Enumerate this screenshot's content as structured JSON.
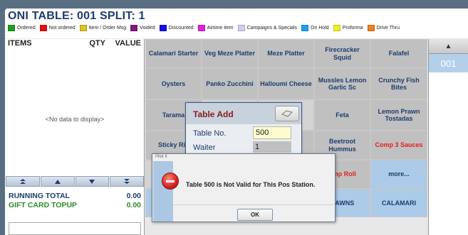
{
  "header": {
    "title": "ONI   TABLE: 001   SPLIT: 1",
    "legend": [
      {
        "label": "Ordered",
        "color": "#1aa01a"
      },
      {
        "label": "Not ordered",
        "color": "#e01010"
      },
      {
        "label": "Item / Order Msg",
        "color": "#e0c020"
      },
      {
        "label": "Voided",
        "color": "#801880"
      },
      {
        "label": "Discounted",
        "color": "#1010e0"
      },
      {
        "label": "Airtime item",
        "color": "#e020e0"
      },
      {
        "label": "Campaigns & Specials",
        "color": "#d0d0f0"
      },
      {
        "label": "On Hold",
        "color": "#20a0f0"
      },
      {
        "label": "Proforma",
        "color": "#f0f020"
      },
      {
        "label": "Drive Thru",
        "color": "#f08020"
      }
    ]
  },
  "items_panel": {
    "col_items": "ITEMS",
    "col_qty": "QTY",
    "col_value": "VALUE",
    "empty_text": "<No data to display>",
    "running_total_label": "RUNNING TOTAL",
    "running_total_value": "0.00",
    "gift_card_label": "GIFT CARD TOPUP",
    "gift_card_value": "0.00"
  },
  "menu_grid": [
    {
      "label": "Calamari Starter",
      "style": ""
    },
    {
      "label": "Veg Meze Platter",
      "style": ""
    },
    {
      "label": "Meze Platter",
      "style": ""
    },
    {
      "label": "Firecracker Squid",
      "style": ""
    },
    {
      "label": "Falafel",
      "style": ""
    },
    {
      "label": "Oysters",
      "style": ""
    },
    {
      "label": "Panko Zucchini",
      "style": ""
    },
    {
      "label": "Halloumi Cheese",
      "style": ""
    },
    {
      "label": "Mussles Lemon Garlic Sc",
      "style": ""
    },
    {
      "label": "Crunchy Fish Bites",
      "style": ""
    },
    {
      "label": "Tarama",
      "style": ""
    },
    {
      "label": "",
      "style": "empty"
    },
    {
      "label": "",
      "style": "empty"
    },
    {
      "label": "Feta",
      "style": ""
    },
    {
      "label": "Lemon Prawn Tostadas",
      "style": ""
    },
    {
      "label": "Sticky Ric",
      "style": ""
    },
    {
      "label": "",
      "style": "empty"
    },
    {
      "label": "e",
      "style": ""
    },
    {
      "label": "Beetroot Hummus",
      "style": ""
    },
    {
      "label": "Comp 3 Sauces",
      "style": "red"
    },
    {
      "label": "",
      "style": "empty"
    },
    {
      "label": "",
      "style": "empty"
    },
    {
      "label": "",
      "style": "empty"
    },
    {
      "label": "omp Roll",
      "style": "red"
    },
    {
      "label": "more...",
      "style": "blue"
    },
    {
      "label": "",
      "style": "blue"
    },
    {
      "label": "",
      "style": "blue"
    },
    {
      "label": "",
      "style": "blue"
    },
    {
      "label": "RAWNS",
      "style": "blue"
    },
    {
      "label": "CALAMARI",
      "style": "blue"
    }
  ],
  "right_panel": {
    "up_arrow": "▲",
    "table_tab": "001"
  },
  "table_add_dialog": {
    "title": "Table Add",
    "table_no_label": "Table No.",
    "table_no_value": "500",
    "waiter_label": "Waiter",
    "waiter_value": "1"
  },
  "message_box": {
    "title": "Pilot II",
    "message": "Table 500 is Not Valid for This Pos Station.",
    "ok_label": "OK"
  }
}
